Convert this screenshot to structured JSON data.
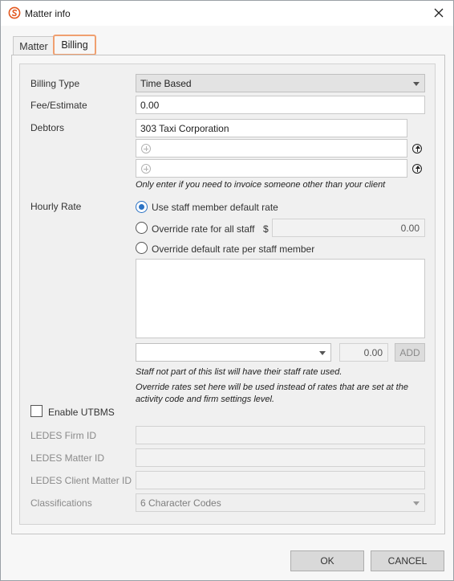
{
  "window": {
    "title": "Matter info"
  },
  "tabs": [
    {
      "label": "Matter"
    },
    {
      "label": "Billing"
    }
  ],
  "billing": {
    "billing_type_label": "Billing Type",
    "billing_type_value": "Time Based",
    "fee_label": "Fee/Estimate",
    "fee_value": "0.00",
    "debtors_label": "Debtors",
    "debtors": [
      "303 Taxi Corporation",
      "",
      ""
    ],
    "debtors_note": "Only enter if you need to invoice someone other than your client",
    "hourly_rate_label": "Hourly Rate",
    "rate_options": [
      "Use staff member default rate",
      "Override rate for all staff",
      "Override default rate per staff member"
    ],
    "selected_rate_option": 0,
    "currency_symbol": "$",
    "override_all_value": "0.00",
    "staff_rate_value": "0.00",
    "add_label": "ADD",
    "staff_note": "Staff not part of this list will have their staff rate used.",
    "override_note": "Override rates set here will be used instead of rates that are set at the activity code and firm settings level.",
    "utbms_label": "Enable UTBMS",
    "utbms_checked": false,
    "ledes_firm_label": "LEDES Firm ID",
    "ledes_matter_label": "LEDES Matter ID",
    "ledes_client_matter_label": "LEDES Client Matter ID",
    "classifications_label": "Classifications",
    "classifications_value": "6 Character Codes"
  },
  "footer": {
    "ok_label": "OK",
    "cancel_label": "CANCEL"
  },
  "colors": {
    "accent": "#2a72c4",
    "tab_highlight": "#f0a070",
    "brand": "#e2571e"
  }
}
